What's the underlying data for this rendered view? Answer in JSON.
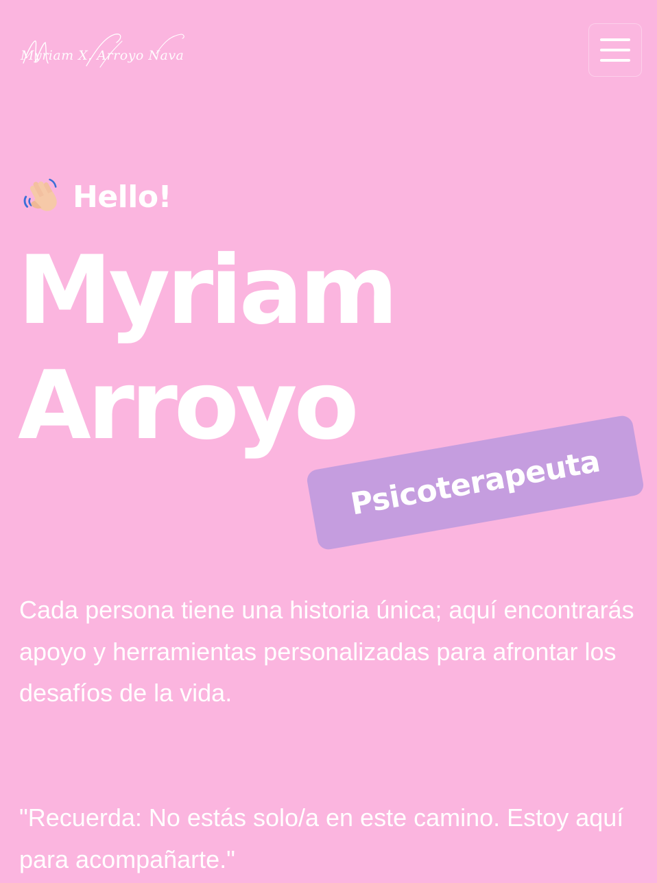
{
  "header": {
    "logo_text": "Myriam X. Arroyo Nava",
    "menu_icon": "hamburger-menu-icon"
  },
  "hero": {
    "greeting_icon": "waving-hand-icon",
    "greeting": "Hello!",
    "name_line1": "Myriam",
    "name_line2": "Arroyo",
    "role": "Psicoterapeuta",
    "intro": "Cada persona tiene una historia única; aquí encontrarás apoyo y herramientas personalizadas para afrontar los desafíos de la vida.",
    "quote": "\"Recuerda: No estás solo/a en este camino. Estoy aquí para acompañarte.\""
  },
  "colors": {
    "background": "#fbb5df",
    "badge": "#c59ddf",
    "text": "#ffffff"
  }
}
